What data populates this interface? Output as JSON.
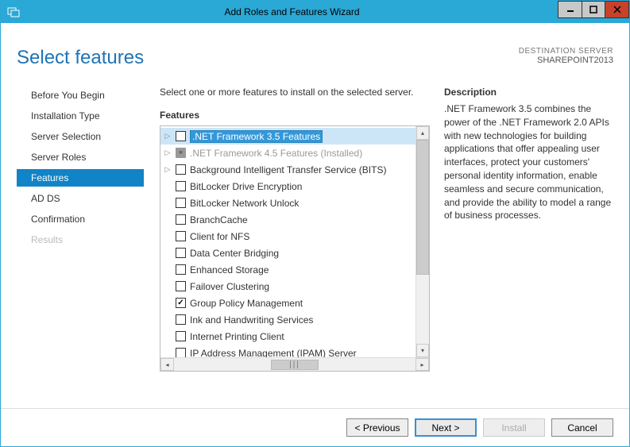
{
  "title": "Add Roles and Features Wizard",
  "page_heading": "Select features",
  "destination": {
    "label": "DESTINATION SERVER",
    "name": "SHAREPOINT2013"
  },
  "sidebar": {
    "items": [
      {
        "label": "Before You Begin",
        "active": false,
        "disabled": false
      },
      {
        "label": "Installation Type",
        "active": false,
        "disabled": false
      },
      {
        "label": "Server Selection",
        "active": false,
        "disabled": false
      },
      {
        "label": "Server Roles",
        "active": false,
        "disabled": false
      },
      {
        "label": "Features",
        "active": true,
        "disabled": false
      },
      {
        "label": "AD DS",
        "active": false,
        "disabled": false
      },
      {
        "label": "Confirmation",
        "active": false,
        "disabled": false
      },
      {
        "label": "Results",
        "active": false,
        "disabled": true
      }
    ]
  },
  "instruction": "Select one or more features to install on the selected server.",
  "features_label": "Features",
  "tree": [
    {
      "label": ".NET Framework 3.5 Features",
      "expandable": true,
      "state": "unchecked",
      "selected": true
    },
    {
      "label": ".NET Framework 4.5 Features (Installed)",
      "expandable": true,
      "state": "installed",
      "disabled": true
    },
    {
      "label": "Background Intelligent Transfer Service (BITS)",
      "expandable": true,
      "state": "unchecked"
    },
    {
      "label": "BitLocker Drive Encryption",
      "expandable": false,
      "state": "unchecked"
    },
    {
      "label": "BitLocker Network Unlock",
      "expandable": false,
      "state": "unchecked"
    },
    {
      "label": "BranchCache",
      "expandable": false,
      "state": "unchecked"
    },
    {
      "label": "Client for NFS",
      "expandable": false,
      "state": "unchecked"
    },
    {
      "label": "Data Center Bridging",
      "expandable": false,
      "state": "unchecked"
    },
    {
      "label": "Enhanced Storage",
      "expandable": false,
      "state": "unchecked"
    },
    {
      "label": "Failover Clustering",
      "expandable": false,
      "state": "unchecked"
    },
    {
      "label": "Group Policy Management",
      "expandable": false,
      "state": "checked"
    },
    {
      "label": "Ink and Handwriting Services",
      "expandable": false,
      "state": "unchecked"
    },
    {
      "label": "Internet Printing Client",
      "expandable": false,
      "state": "unchecked"
    },
    {
      "label": "IP Address Management (IPAM) Server",
      "expandable": false,
      "state": "unchecked"
    }
  ],
  "description": {
    "label": "Description",
    "text": ".NET Framework 3.5 combines the power of the .NET Framework 2.0 APIs with new technologies for building applications that offer appealing user interfaces, protect your customers' personal identity information, enable seamless and secure communication, and provide the ability to model a range of business processes."
  },
  "buttons": {
    "previous": "< Previous",
    "next": "Next >",
    "install": "Install",
    "cancel": "Cancel"
  }
}
